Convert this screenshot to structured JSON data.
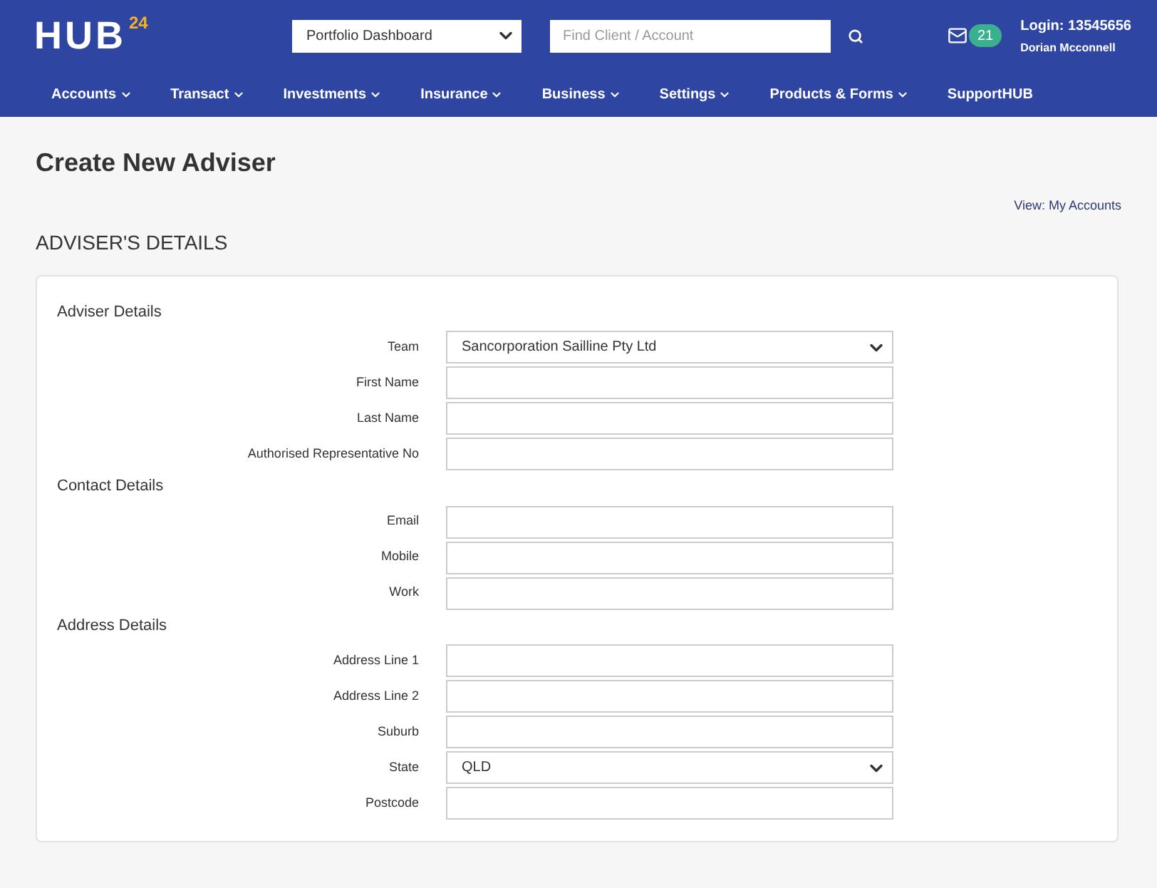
{
  "logo": {
    "text": "HUB",
    "superscript": "24"
  },
  "header": {
    "dashboard_select": "Portfolio Dashboard",
    "search": {
      "placeholder": "Find Client / Account"
    },
    "message_count": "21",
    "login": "Login: 13545656",
    "user": "Dorian Mcconnell"
  },
  "nav": [
    {
      "label": "Accounts",
      "dropdown": true
    },
    {
      "label": "Transact",
      "dropdown": true
    },
    {
      "label": "Investments",
      "dropdown": true
    },
    {
      "label": "Insurance",
      "dropdown": true
    },
    {
      "label": "Business",
      "dropdown": true
    },
    {
      "label": "Settings",
      "dropdown": true
    },
    {
      "label": "Products & Forms",
      "dropdown": true
    },
    {
      "label": "SupportHUB",
      "dropdown": false
    }
  ],
  "page_title": "Create New Adviser",
  "view_link": "View: My Accounts",
  "section_title": "ADVISER'S DETAILS",
  "sections": [
    {
      "title": "Adviser Details",
      "fields": [
        {
          "label": "Team",
          "kind": "select",
          "value": "Sancorporation Sailline Pty Ltd"
        },
        {
          "label": "First Name",
          "kind": "text"
        },
        {
          "label": "Last Name",
          "kind": "text"
        },
        {
          "label": "Authorised Representative No",
          "kind": "text"
        }
      ]
    },
    {
      "title": "Contact Details",
      "fields": [
        {
          "label": "Email",
          "kind": "text"
        },
        {
          "label": "Mobile",
          "kind": "text"
        },
        {
          "label": "Work",
          "kind": "text"
        }
      ]
    },
    {
      "title": "Address Details",
      "fields": [
        {
          "label": "Address Line 1",
          "kind": "text"
        },
        {
          "label": "Address Line 2",
          "kind": "text"
        },
        {
          "label": "Suburb",
          "kind": "text"
        },
        {
          "label": "State",
          "kind": "select",
          "value": "QLD"
        },
        {
          "label": "Postcode",
          "kind": "text"
        }
      ]
    }
  ]
}
